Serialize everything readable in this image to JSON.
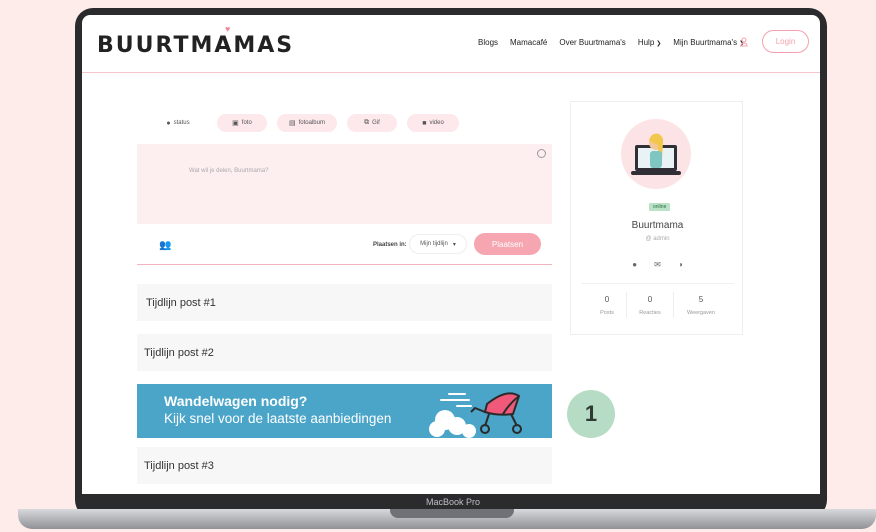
{
  "device": {
    "label": "MacBook Pro"
  },
  "header": {
    "logo": "BUURTMAMAS",
    "nav": [
      {
        "label": "Blogs",
        "dropdown": false
      },
      {
        "label": "Mamacafé",
        "dropdown": false
      },
      {
        "label": "Over Buurtmama's",
        "dropdown": false
      },
      {
        "label": "Hulp",
        "dropdown": true
      },
      {
        "label": "Mijn Buurtmama's",
        "dropdown": true
      }
    ],
    "login_label": "Login"
  },
  "composer": {
    "tabs": [
      {
        "label": "status",
        "icon": "speech-bubble-icon"
      },
      {
        "label": "foto",
        "icon": "camera-icon"
      },
      {
        "label": "fotoalbum",
        "icon": "album-icon"
      },
      {
        "label": "Gif",
        "icon": "gif-icon"
      },
      {
        "label": "video",
        "icon": "video-icon"
      }
    ],
    "placeholder": "Wat wil je delen, Buurtmama?",
    "place_in_label": "Plaatsen in:",
    "place_in_value": "Mijn tijdlijn",
    "submit_label": "Plaatsen"
  },
  "posts": [
    {
      "title": "Tijdlijn post #1"
    },
    {
      "title": "Tijdlijn post #2"
    },
    {
      "title": "Tijdlijn post #3"
    }
  ],
  "banner": {
    "title": "Wandelwagen nodig?",
    "subtitle": "Kijk snel voor de laatste aanbiedingen",
    "background": "#4aa5c9"
  },
  "step_badge": "1",
  "profile": {
    "status": "online",
    "name": "Buurtmama",
    "username": "@ admin",
    "stats": [
      {
        "value": "0",
        "label": "Posts"
      },
      {
        "value": "0",
        "label": "Reacties"
      },
      {
        "value": "5",
        "label": "Weergaven"
      }
    ]
  },
  "colors": {
    "background": "#fdecea",
    "accent_pink": "#f6a6b1",
    "online_green": "#b9e2c7",
    "badge_green": "#b7dcc6"
  }
}
